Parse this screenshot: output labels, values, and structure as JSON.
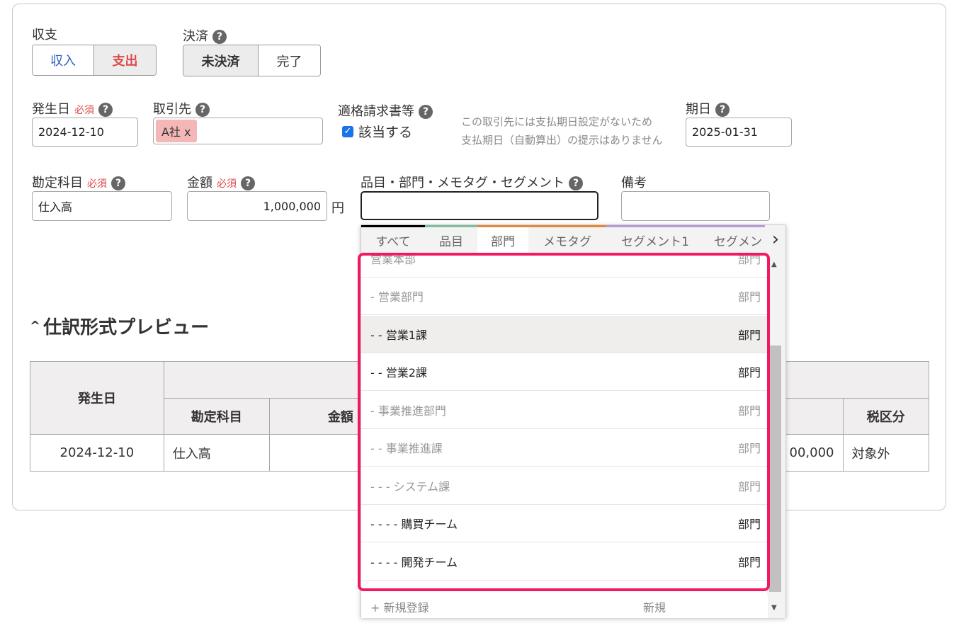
{
  "form": {
    "income_expense": {
      "label": "収支",
      "options": [
        "収入",
        "支出"
      ],
      "selected": "支出"
    },
    "settlement": {
      "label": "決済",
      "options": [
        "未決済",
        "完了"
      ],
      "selected": "未決済"
    },
    "date": {
      "label": "発生日",
      "required": "必須",
      "value": "2024-12-10"
    },
    "partner": {
      "label": "取引先",
      "chip": "A社 x"
    },
    "invoice": {
      "label": "適格請求書等",
      "checkbox_label": "該当する",
      "checked": true
    },
    "notice_line1": "この取引先には支払期日設定がないため",
    "notice_line2": "支払期日（自動算出）の提示はありません",
    "due_date": {
      "label": "期日",
      "value": "2025-01-31"
    },
    "account": {
      "label": "勘定科目",
      "required": "必須",
      "value": "仕入高"
    },
    "amount": {
      "label": "金額",
      "required": "必須",
      "value": "1,000,000",
      "unit": "円"
    },
    "tags": {
      "label": "品目・部門・メモタグ・セグメント",
      "value": ""
    },
    "memo": {
      "label": "備考",
      "value": ""
    },
    "help_icon_glyph": "?"
  },
  "preview": {
    "toggle_glyph": "^",
    "title": "仕訳形式プレビュー",
    "headers": {
      "date": "発生日",
      "account": "勘定科目",
      "amount": "金額",
      "tax": "税区分"
    },
    "row": {
      "date": "2024-12-10",
      "account": "仕入高",
      "amount_tail": "00,000",
      "tax": "対象外"
    }
  },
  "dropdown": {
    "tabs": [
      {
        "label": "すべて",
        "color": "#000000"
      },
      {
        "label": "品目",
        "color": "#7fbfa0"
      },
      {
        "label": "部門",
        "color": "#e08a3a",
        "active": true
      },
      {
        "label": "メモタグ",
        "color": "#e08a3a"
      },
      {
        "label": "セグメント1",
        "color": "#b79ad8"
      },
      {
        "label": "セグメン",
        "color": "#b79ad8"
      }
    ],
    "next_glyph": "›",
    "items": [
      {
        "name": "営業本部",
        "type": "部門",
        "state": "dim"
      },
      {
        "name": "- 営業部門",
        "type": "部門",
        "state": "dim"
      },
      {
        "name": "- - 営業1課",
        "type": "部門",
        "state": "strong",
        "highlighted": true
      },
      {
        "name": "- - 営業2課",
        "type": "部門",
        "state": "strong"
      },
      {
        "name": "- 事業推進部門",
        "type": "部門",
        "state": "dim"
      },
      {
        "name": "- - 事業推進課",
        "type": "部門",
        "state": "dim"
      },
      {
        "name": "- - - システム課",
        "type": "部門",
        "state": "dim"
      },
      {
        "name": "- - - - 購買チーム",
        "type": "部門",
        "state": "strong"
      },
      {
        "name": "- - - - 開発チーム",
        "type": "部門",
        "state": "strong"
      }
    ],
    "footer": {
      "label": "+ 新規登録",
      "type": "新規"
    },
    "scroll_up_glyph": "▲",
    "scroll_down_glyph": "▼",
    "highlight_color": "#f01a60"
  }
}
